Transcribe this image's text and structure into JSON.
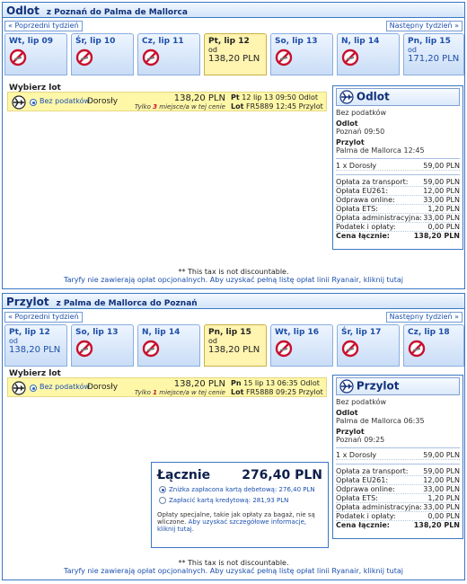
{
  "colors": {
    "accent": "#3a78c3",
    "selected_day": "#fff4b0",
    "flight_row": "#fff7a8",
    "no_flight": "#c8102e"
  },
  "icons": {
    "plane": "plane-icon",
    "no_flight": "no-flight-icon",
    "radio": "radio-icon"
  },
  "outbound": {
    "title": "Odlot",
    "route": "z Poznań do Palma de Mallorca",
    "prev_week": "« Poprzedni tydzień",
    "next_week": "Następny tydzień »",
    "days": [
      {
        "date": "Wt, lip 09",
        "available": false
      },
      {
        "date": "Śr, lip 10",
        "available": false
      },
      {
        "date": "Cz, lip 11",
        "available": false
      },
      {
        "date": "Pt, lip 12",
        "available": true,
        "selected": true,
        "od": "od",
        "price": "138,20 PLN"
      },
      {
        "date": "So, lip 13",
        "available": false
      },
      {
        "date": "N, lip 14",
        "available": false
      },
      {
        "date": "Pn, lip 15",
        "available": true,
        "selected": false,
        "od": "od",
        "price": "171,20 PLN"
      }
    ],
    "pick_label": "Wybierz lot",
    "flight": {
      "fare": "Bez podatków",
      "passenger": "Dorosły",
      "price": "138,20 PLN",
      "seats_prefix": "Tylko",
      "seats_count": "3",
      "seats_suffix": "miejsce/a w tej cenie",
      "dep_day": "Pt",
      "dep_text": "12 lip 13 09:50 Odlot",
      "lot": "Lot",
      "arr_text": "FR5889 12:45 Przylot"
    },
    "summary": {
      "title": "Odlot",
      "fare_type": "Bez podatków",
      "departure_label": "Odlot",
      "departure_value": "Poznań 09:50",
      "arrival_label": "Przylot",
      "arrival_value": "Palma de Mallorca 12:45",
      "pax_label": "1 x Dorosły",
      "pax_amount": "59,00 PLN",
      "fees": [
        {
          "name": "Opłata za transport:",
          "amount": "59,00 PLN"
        },
        {
          "name": "Opłata EU261:",
          "amount": "12,00 PLN"
        },
        {
          "name": "Odprawa online:",
          "amount": "33,00 PLN"
        },
        {
          "name": "Opłata ETS:",
          "amount": "1,20 PLN"
        },
        {
          "name": "Opłata administracyjna:",
          "amount": "33,00 PLN"
        },
        {
          "name": "Podatek i opłaty:",
          "amount": "0,00 PLN"
        }
      ],
      "total_label": "Cena łącznie:",
      "total_amount": "138,20 PLN"
    },
    "tax_note": "** This tax is not discountable.",
    "ryanair_note": "Taryfy nie zawierają opłat opcjonalnych. Aby uzyskać pełną listę opłat linii Ryanair, kliknij tutaj"
  },
  "return": {
    "title": "Przylot",
    "route": "z Palma de Mallorca do Poznań",
    "prev_week": "« Poprzedni tydzień",
    "next_week": "Następny tydzień »",
    "days": [
      {
        "date": "Pt, lip 12",
        "available": true,
        "selected": false,
        "od": "od",
        "price": "138,20 PLN"
      },
      {
        "date": "So, lip 13",
        "available": false
      },
      {
        "date": "N, lip 14",
        "available": false
      },
      {
        "date": "Pn, lip 15",
        "available": true,
        "selected": true,
        "od": "od",
        "price": "138,20 PLN"
      },
      {
        "date": "Wt, lip 16",
        "available": false
      },
      {
        "date": "Śr, lip 17",
        "available": false
      },
      {
        "date": "Cz, lip 18",
        "available": false
      }
    ],
    "pick_label": "Wybierz lot",
    "flight": {
      "fare": "Bez podatków",
      "passenger": "Dorosły",
      "price": "138,20 PLN",
      "seats_prefix": "Tylko",
      "seats_count": "1",
      "seats_suffix": "miejsce/a w tej cenie",
      "dep_day": "Pn",
      "dep_text": "15 lip 13 06:35 Odlot",
      "lot": "Lot",
      "arr_text": "FR5888 09:25 Przylot"
    },
    "summary": {
      "title": "Przylot",
      "fare_type": "Bez podatków",
      "departure_label": "Odlot",
      "departure_value": "Palma de Mallorca 06:35",
      "arrival_label": "Przylot",
      "arrival_value": "Poznań 09:25",
      "pax_label": "1 x Dorosły",
      "pax_amount": "59,00 PLN",
      "fees": [
        {
          "name": "Opłata za transport:",
          "amount": "59,00 PLN"
        },
        {
          "name": "Opłata EU261:",
          "amount": "12,00 PLN"
        },
        {
          "name": "Odprawa online:",
          "amount": "33,00 PLN"
        },
        {
          "name": "Opłata ETS:",
          "amount": "1,20 PLN"
        },
        {
          "name": "Opłata administracyjna:",
          "amount": "33,00 PLN"
        },
        {
          "name": "Podatek i opłaty:",
          "amount": "0,00 PLN"
        }
      ],
      "total_label": "Cena łącznie:",
      "total_amount": "138,20 PLN"
    },
    "tax_note": "** This tax is not discountable.",
    "ryanair_note": "Taryfy nie zawierają opłat opcjonalnych. Aby uzyskać pełną listę opłat linii Ryanair, kliknij tutaj"
  },
  "total": {
    "label": "Łącznie",
    "amount": "276,40 PLN",
    "option_debit": "Zniżka zapłacona kartą debetową: 276,40 PLN",
    "option_credit": "Zapłacić kartą kredytową: 281,93 PLN",
    "fees_note": "Opłaty specjalne, takie jak opłaty za bagaż, nie są wliczone.",
    "fees_link": "Aby uzyskać szczegółowe informacje, kliknij tutaj."
  }
}
